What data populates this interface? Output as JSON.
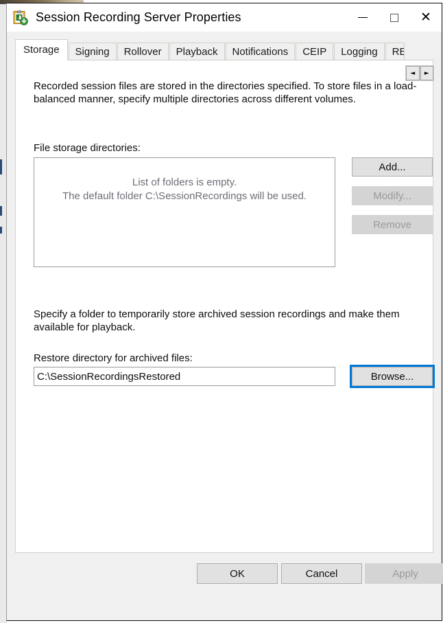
{
  "window": {
    "title": "Session Recording Server Properties",
    "icon": "clipboard-recording-icon",
    "controls": {
      "minimize": "—",
      "maximize": "□",
      "close": "✕"
    }
  },
  "tabs": {
    "items": [
      {
        "label": "Storage",
        "active": true
      },
      {
        "label": "Signing",
        "active": false
      },
      {
        "label": "Rollover",
        "active": false
      },
      {
        "label": "Playback",
        "active": false
      },
      {
        "label": "Notifications",
        "active": false
      },
      {
        "label": "CEIP",
        "active": false
      },
      {
        "label": "Logging",
        "active": false
      },
      {
        "label": "RE",
        "active": false
      }
    ],
    "scroll_left": "◄",
    "scroll_right": "►"
  },
  "storage_tab": {
    "intro_text": "Recorded session files are stored in the directories specified. To store files in a load-balanced manner, specify multiple directories across different volumes.",
    "file_storage_label": "File storage directories:",
    "listbox_empty_text": "List of folders is empty.\nThe default folder C:\\SessionRecordings will be used.",
    "buttons": {
      "add": "Add...",
      "modify": "Modify...",
      "remove": "Remove"
    },
    "archive_text": "Specify a folder to temporarily store archived session recordings and make them available for playback.",
    "restore_label": "Restore directory for archived files:",
    "restore_value": "C:\\SessionRecordingsRestored",
    "browse": "Browse..."
  },
  "footer": {
    "ok": "OK",
    "cancel": "Cancel",
    "apply": "Apply"
  },
  "colors": {
    "focus_ring": "#0078d7",
    "dialog_bg": "#f0f0f0",
    "panel_bg": "#ffffff",
    "disabled_text": "#9a9a9a",
    "hint_text": "#6d6d78"
  }
}
